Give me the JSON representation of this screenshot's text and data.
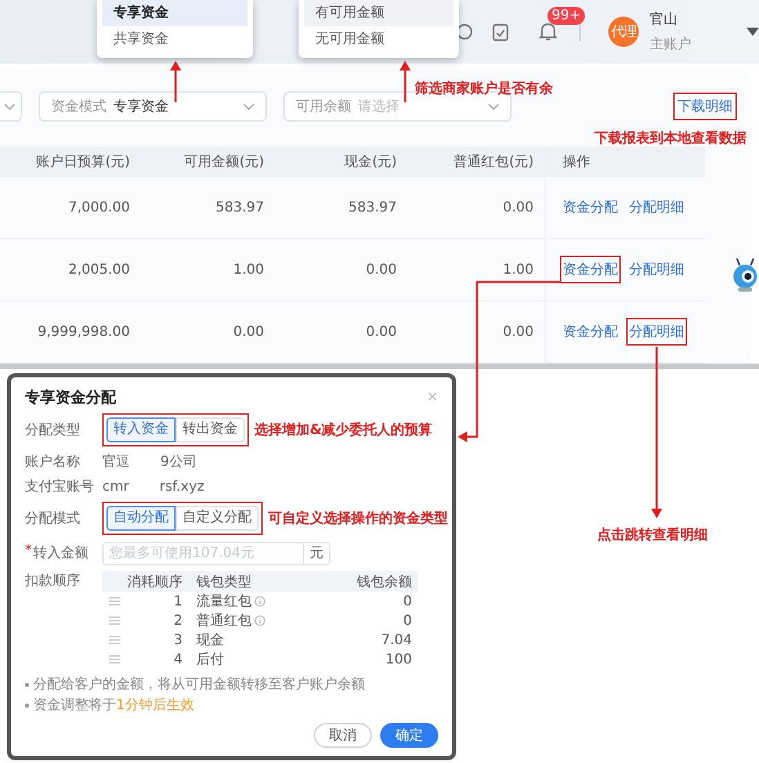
{
  "header": {
    "notification_badge": "99+",
    "avatar": "代理",
    "user_name": "官山",
    "user_role": "主账户"
  },
  "dropdown_menus": [
    {
      "options": [
        {
          "label": "专享资金",
          "selected": true
        },
        {
          "label": "共享资金",
          "selected": false
        }
      ]
    },
    {
      "options": [
        {
          "label": "有可用金额",
          "selected": true
        },
        {
          "label": "无可用金额",
          "selected": false
        }
      ]
    }
  ],
  "filters": [
    {
      "label": "资金模式",
      "value": "专享资金"
    },
    {
      "label": "可用余额",
      "placeholder": "请选择"
    }
  ],
  "download_link": {
    "label": "下载明细",
    "highlighted": true
  },
  "table": {
    "columns": [
      "账户日预算(元)",
      "可用金额(元)",
      "现金(元)",
      "普通红包(元)",
      "操作"
    ],
    "rows": [
      {
        "cells": [
          "7,000.00",
          "583.97",
          "583.97",
          "0.00"
        ],
        "actions": [
          {
            "label": "资金分配",
            "highlighted": false
          },
          {
            "label": "分配明细",
            "highlighted": false
          }
        ]
      },
      {
        "cells": [
          "2,005.00",
          "1.00",
          "0.00",
          "1.00"
        ],
        "actions": [
          {
            "label": "资金分配",
            "highlighted": true
          },
          {
            "label": "分配明细",
            "highlighted": false
          }
        ]
      },
      {
        "cells": [
          "9,999,998.00",
          "0.00",
          "0.00",
          "0.00"
        ],
        "actions": [
          {
            "label": "资金分配",
            "highlighted": false
          },
          {
            "label": "分配明细",
            "highlighted": true
          }
        ]
      }
    ]
  },
  "modal": {
    "title": "专享资金分配",
    "close": "×",
    "allocation_type": {
      "label": "分配类型",
      "highlighted": true,
      "options": [
        {
          "label": "转入资金",
          "selected": true
        },
        {
          "label": "转出资金",
          "selected": false
        }
      ]
    },
    "account_name": {
      "label": "账户名称",
      "values": [
        "官逗",
        "9公司"
      ]
    },
    "alipay": {
      "label": "支付宝账号",
      "values": [
        "cmr",
        "rsf.xyz"
      ]
    },
    "allocation_mode": {
      "label": "分配模式",
      "highlighted": true,
      "options": [
        {
          "label": "自动分配",
          "selected": true
        },
        {
          "label": "自定义分配",
          "selected": false
        }
      ]
    },
    "amount": {
      "required_mark": "*",
      "label": "转入金额",
      "placeholder": "您最多可使用107.04元",
      "suffix": "元"
    },
    "deduction": {
      "label": "扣款顺序",
      "columns": [
        "消耗顺序",
        "钱包类型",
        "钱包余额"
      ],
      "rows": [
        {
          "order": "1",
          "type": "流量红包",
          "info": true,
          "balance": "0"
        },
        {
          "order": "2",
          "type": "普通红包",
          "info": true,
          "balance": "0"
        },
        {
          "order": "3",
          "type": "现金",
          "info": false,
          "balance": "7.04"
        },
        {
          "order": "4",
          "type": "后付",
          "info": false,
          "balance": "100"
        }
      ]
    },
    "notes": [
      {
        "text": "分配给客户的金额，将从可用金额转移至客户账户余额"
      },
      {
        "text": "资金调整将于",
        "highlight": "1分钟后生效"
      }
    ],
    "buttons": [
      {
        "label": "取消",
        "kind": "secondary"
      },
      {
        "label": "确定",
        "kind": "primary"
      }
    ]
  },
  "annotations": [
    "筛选商家账户是否有余",
    "下载报表到本地查看数据",
    "选择增加&减少委托人的预算",
    "可自定义选择操作的资金类型",
    "点击跳转查看明细"
  ]
}
